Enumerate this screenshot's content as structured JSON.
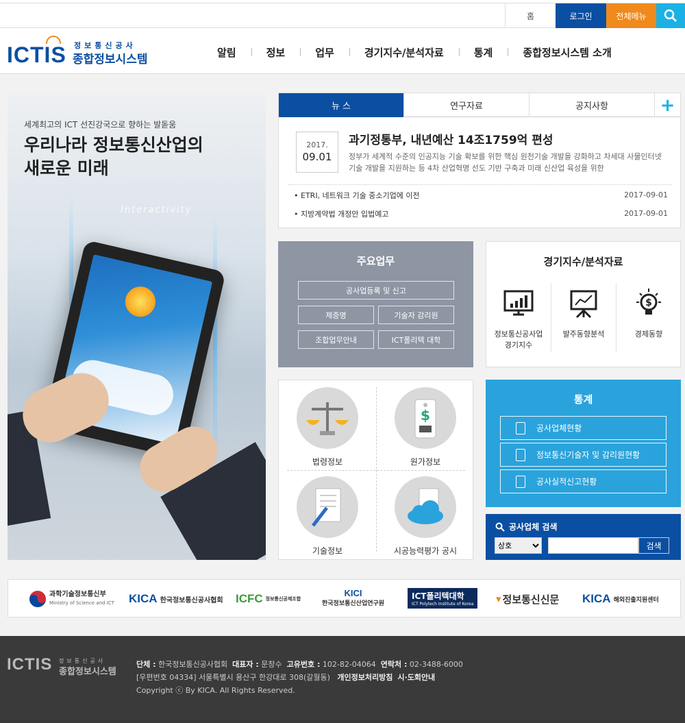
{
  "topbar": {
    "home": "홈",
    "login": "로그인",
    "all_menu": "전체메뉴"
  },
  "logo": {
    "main": "ICTIS",
    "sub1": "정보통신공사",
    "sub2": "종합정보시스템"
  },
  "nav": [
    "알림",
    "정보",
    "업무",
    "경기지수/분석자료",
    "통계",
    "종합정보시스템 소개"
  ],
  "hero": {
    "small": "세계최고의 ICT 선진강국으로 향하는 발돋움",
    "line1": "우리나라 정보통신산업의",
    "line2": "새로운 미래",
    "overlay": "Interactivity"
  },
  "news": {
    "tabs": [
      "뉴 스",
      "연구자료",
      "공지사항"
    ],
    "plus": "+",
    "featured": {
      "year": "2017.",
      "day": "09.01",
      "title": "과기정통부, 내년예산 14조1759억 편성",
      "summary": "정부가 세계적 수준의 인공지능 기술 확보를 위한 핵심 원천기술 개발을 강화하고 차세대 사물인터넷 기술 개발을 지원하는 등 4차 산업혁명 선도 기반 구축과 미래 신산업 육성을 위한"
    },
    "items": [
      {
        "title": "ETRI, 네트워크 기술 중소기업에 이전",
        "date": "2017-09-01"
      },
      {
        "title": "지방계약법 개정안 입법예고",
        "date": "2017-09-01"
      }
    ]
  },
  "business": {
    "title": "주요업무",
    "buttons": [
      "공사업등록 및 신고",
      "제증명",
      "기술자 감리원",
      "조합업무안내",
      "ICT폴리텍 대학"
    ]
  },
  "index": {
    "title": "경기지수/분석자료",
    "items": [
      {
        "label1": "정보통신공사업",
        "label2": "경기지수",
        "icon": "chart-monitor-icon"
      },
      {
        "label1": "발주동향분석",
        "label2": "",
        "icon": "presentation-board-icon"
      },
      {
        "label1": "경제동향",
        "label2": "",
        "icon": "lightbulb-dollar-icon"
      }
    ]
  },
  "info": {
    "items": [
      {
        "label": "법령정보",
        "icon": "scale-icon"
      },
      {
        "label": "원가정보",
        "icon": "price-tag-icon"
      },
      {
        "label": "기술정보",
        "icon": "document-pen-icon"
      },
      {
        "label": "시공능력평가 공시",
        "icon": "cloud-icon"
      }
    ]
  },
  "stats": {
    "title": "통계",
    "items": [
      "공사업체현황",
      "정보통신기술자 및 감리원현황",
      "공사실적신고현황"
    ]
  },
  "company_search": {
    "title": "공사업체 검색",
    "select_value": "상호",
    "button": "검색"
  },
  "partners": [
    "과학기술정보통신부",
    "한국정보통신공사협회",
    "정보통신공제조합",
    "한국정보통신산업연구원",
    "ICT폴리텍대학",
    "정보통신신문",
    "해외진출지원센터"
  ],
  "partner_marks": {
    "kica1": "KICA",
    "icfc": "ICFC",
    "kici": "KICI",
    "kica2": "KICA",
    "ministry_en": "Ministry of Science and ICT",
    "polytech_en": "ICT Polytech Institute of Korea"
  },
  "footer": {
    "logo_main": "ICTIS",
    "logo_sub1": "정보통신공사",
    "logo_sub2": "종합정보시스템",
    "org_label": "단체 :",
    "org": "한국정보통신공사협회",
    "ceo_label": "대표자 :",
    "ceo": "문창수",
    "biz_label": "고유번호 :",
    "biz": "102-82-04064",
    "tel_label": "연락처 :",
    "tel": "02-3488-6000",
    "address": "[우편번호 04334] 서울특별시 용산구 한강대로 308(갈월동)",
    "privacy": "개인정보처리방침",
    "city": "시·도회안내",
    "copyright": "Copyright ⓒ By KICA. All Rights Reserved."
  },
  "colors": {
    "primary": "#0b4fa2",
    "accent": "#f08a1c",
    "sky": "#1ab1e6",
    "stats": "#2aa3dc",
    "biz": "#8e96a4"
  }
}
